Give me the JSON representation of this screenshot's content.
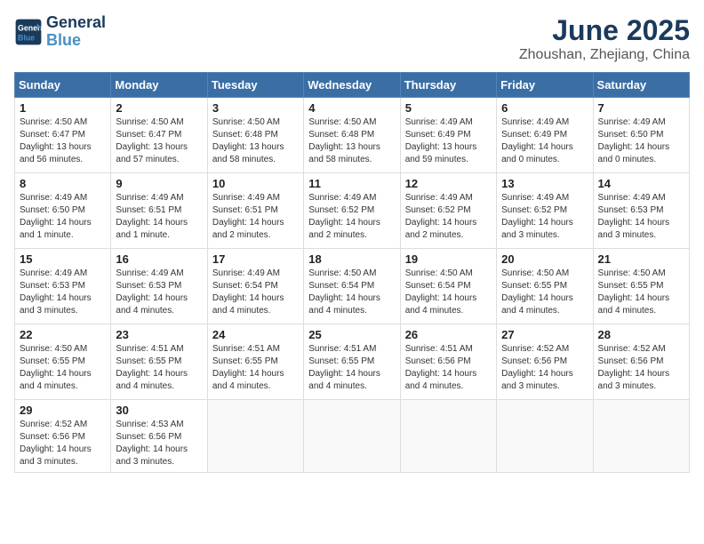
{
  "header": {
    "logo_line1": "General",
    "logo_line2": "Blue",
    "month": "June 2025",
    "location": "Zhoushan, Zhejiang, China"
  },
  "weekdays": [
    "Sunday",
    "Monday",
    "Tuesday",
    "Wednesday",
    "Thursday",
    "Friday",
    "Saturday"
  ],
  "weeks": [
    [
      {
        "day": "1",
        "lines": [
          "Sunrise: 4:50 AM",
          "Sunset: 6:47 PM",
          "Daylight: 13 hours",
          "and 56 minutes."
        ]
      },
      {
        "day": "2",
        "lines": [
          "Sunrise: 4:50 AM",
          "Sunset: 6:47 PM",
          "Daylight: 13 hours",
          "and 57 minutes."
        ]
      },
      {
        "day": "3",
        "lines": [
          "Sunrise: 4:50 AM",
          "Sunset: 6:48 PM",
          "Daylight: 13 hours",
          "and 58 minutes."
        ]
      },
      {
        "day": "4",
        "lines": [
          "Sunrise: 4:50 AM",
          "Sunset: 6:48 PM",
          "Daylight: 13 hours",
          "and 58 minutes."
        ]
      },
      {
        "day": "5",
        "lines": [
          "Sunrise: 4:49 AM",
          "Sunset: 6:49 PM",
          "Daylight: 13 hours",
          "and 59 minutes."
        ]
      },
      {
        "day": "6",
        "lines": [
          "Sunrise: 4:49 AM",
          "Sunset: 6:49 PM",
          "Daylight: 14 hours",
          "and 0 minutes."
        ]
      },
      {
        "day": "7",
        "lines": [
          "Sunrise: 4:49 AM",
          "Sunset: 6:50 PM",
          "Daylight: 14 hours",
          "and 0 minutes."
        ]
      }
    ],
    [
      {
        "day": "8",
        "lines": [
          "Sunrise: 4:49 AM",
          "Sunset: 6:50 PM",
          "Daylight: 14 hours",
          "and 1 minute."
        ]
      },
      {
        "day": "9",
        "lines": [
          "Sunrise: 4:49 AM",
          "Sunset: 6:51 PM",
          "Daylight: 14 hours",
          "and 1 minute."
        ]
      },
      {
        "day": "10",
        "lines": [
          "Sunrise: 4:49 AM",
          "Sunset: 6:51 PM",
          "Daylight: 14 hours",
          "and 2 minutes."
        ]
      },
      {
        "day": "11",
        "lines": [
          "Sunrise: 4:49 AM",
          "Sunset: 6:52 PM",
          "Daylight: 14 hours",
          "and 2 minutes."
        ]
      },
      {
        "day": "12",
        "lines": [
          "Sunrise: 4:49 AM",
          "Sunset: 6:52 PM",
          "Daylight: 14 hours",
          "and 2 minutes."
        ]
      },
      {
        "day": "13",
        "lines": [
          "Sunrise: 4:49 AM",
          "Sunset: 6:52 PM",
          "Daylight: 14 hours",
          "and 3 minutes."
        ]
      },
      {
        "day": "14",
        "lines": [
          "Sunrise: 4:49 AM",
          "Sunset: 6:53 PM",
          "Daylight: 14 hours",
          "and 3 minutes."
        ]
      }
    ],
    [
      {
        "day": "15",
        "lines": [
          "Sunrise: 4:49 AM",
          "Sunset: 6:53 PM",
          "Daylight: 14 hours",
          "and 3 minutes."
        ]
      },
      {
        "day": "16",
        "lines": [
          "Sunrise: 4:49 AM",
          "Sunset: 6:53 PM",
          "Daylight: 14 hours",
          "and 4 minutes."
        ]
      },
      {
        "day": "17",
        "lines": [
          "Sunrise: 4:49 AM",
          "Sunset: 6:54 PM",
          "Daylight: 14 hours",
          "and 4 minutes."
        ]
      },
      {
        "day": "18",
        "lines": [
          "Sunrise: 4:50 AM",
          "Sunset: 6:54 PM",
          "Daylight: 14 hours",
          "and 4 minutes."
        ]
      },
      {
        "day": "19",
        "lines": [
          "Sunrise: 4:50 AM",
          "Sunset: 6:54 PM",
          "Daylight: 14 hours",
          "and 4 minutes."
        ]
      },
      {
        "day": "20",
        "lines": [
          "Sunrise: 4:50 AM",
          "Sunset: 6:55 PM",
          "Daylight: 14 hours",
          "and 4 minutes."
        ]
      },
      {
        "day": "21",
        "lines": [
          "Sunrise: 4:50 AM",
          "Sunset: 6:55 PM",
          "Daylight: 14 hours",
          "and 4 minutes."
        ]
      }
    ],
    [
      {
        "day": "22",
        "lines": [
          "Sunrise: 4:50 AM",
          "Sunset: 6:55 PM",
          "Daylight: 14 hours",
          "and 4 minutes."
        ]
      },
      {
        "day": "23",
        "lines": [
          "Sunrise: 4:51 AM",
          "Sunset: 6:55 PM",
          "Daylight: 14 hours",
          "and 4 minutes."
        ]
      },
      {
        "day": "24",
        "lines": [
          "Sunrise: 4:51 AM",
          "Sunset: 6:55 PM",
          "Daylight: 14 hours",
          "and 4 minutes."
        ]
      },
      {
        "day": "25",
        "lines": [
          "Sunrise: 4:51 AM",
          "Sunset: 6:55 PM",
          "Daylight: 14 hours",
          "and 4 minutes."
        ]
      },
      {
        "day": "26",
        "lines": [
          "Sunrise: 4:51 AM",
          "Sunset: 6:56 PM",
          "Daylight: 14 hours",
          "and 4 minutes."
        ]
      },
      {
        "day": "27",
        "lines": [
          "Sunrise: 4:52 AM",
          "Sunset: 6:56 PM",
          "Daylight: 14 hours",
          "and 3 minutes."
        ]
      },
      {
        "day": "28",
        "lines": [
          "Sunrise: 4:52 AM",
          "Sunset: 6:56 PM",
          "Daylight: 14 hours",
          "and 3 minutes."
        ]
      }
    ],
    [
      {
        "day": "29",
        "lines": [
          "Sunrise: 4:52 AM",
          "Sunset: 6:56 PM",
          "Daylight: 14 hours",
          "and 3 minutes."
        ]
      },
      {
        "day": "30",
        "lines": [
          "Sunrise: 4:53 AM",
          "Sunset: 6:56 PM",
          "Daylight: 14 hours",
          "and 3 minutes."
        ]
      },
      null,
      null,
      null,
      null,
      null
    ]
  ]
}
